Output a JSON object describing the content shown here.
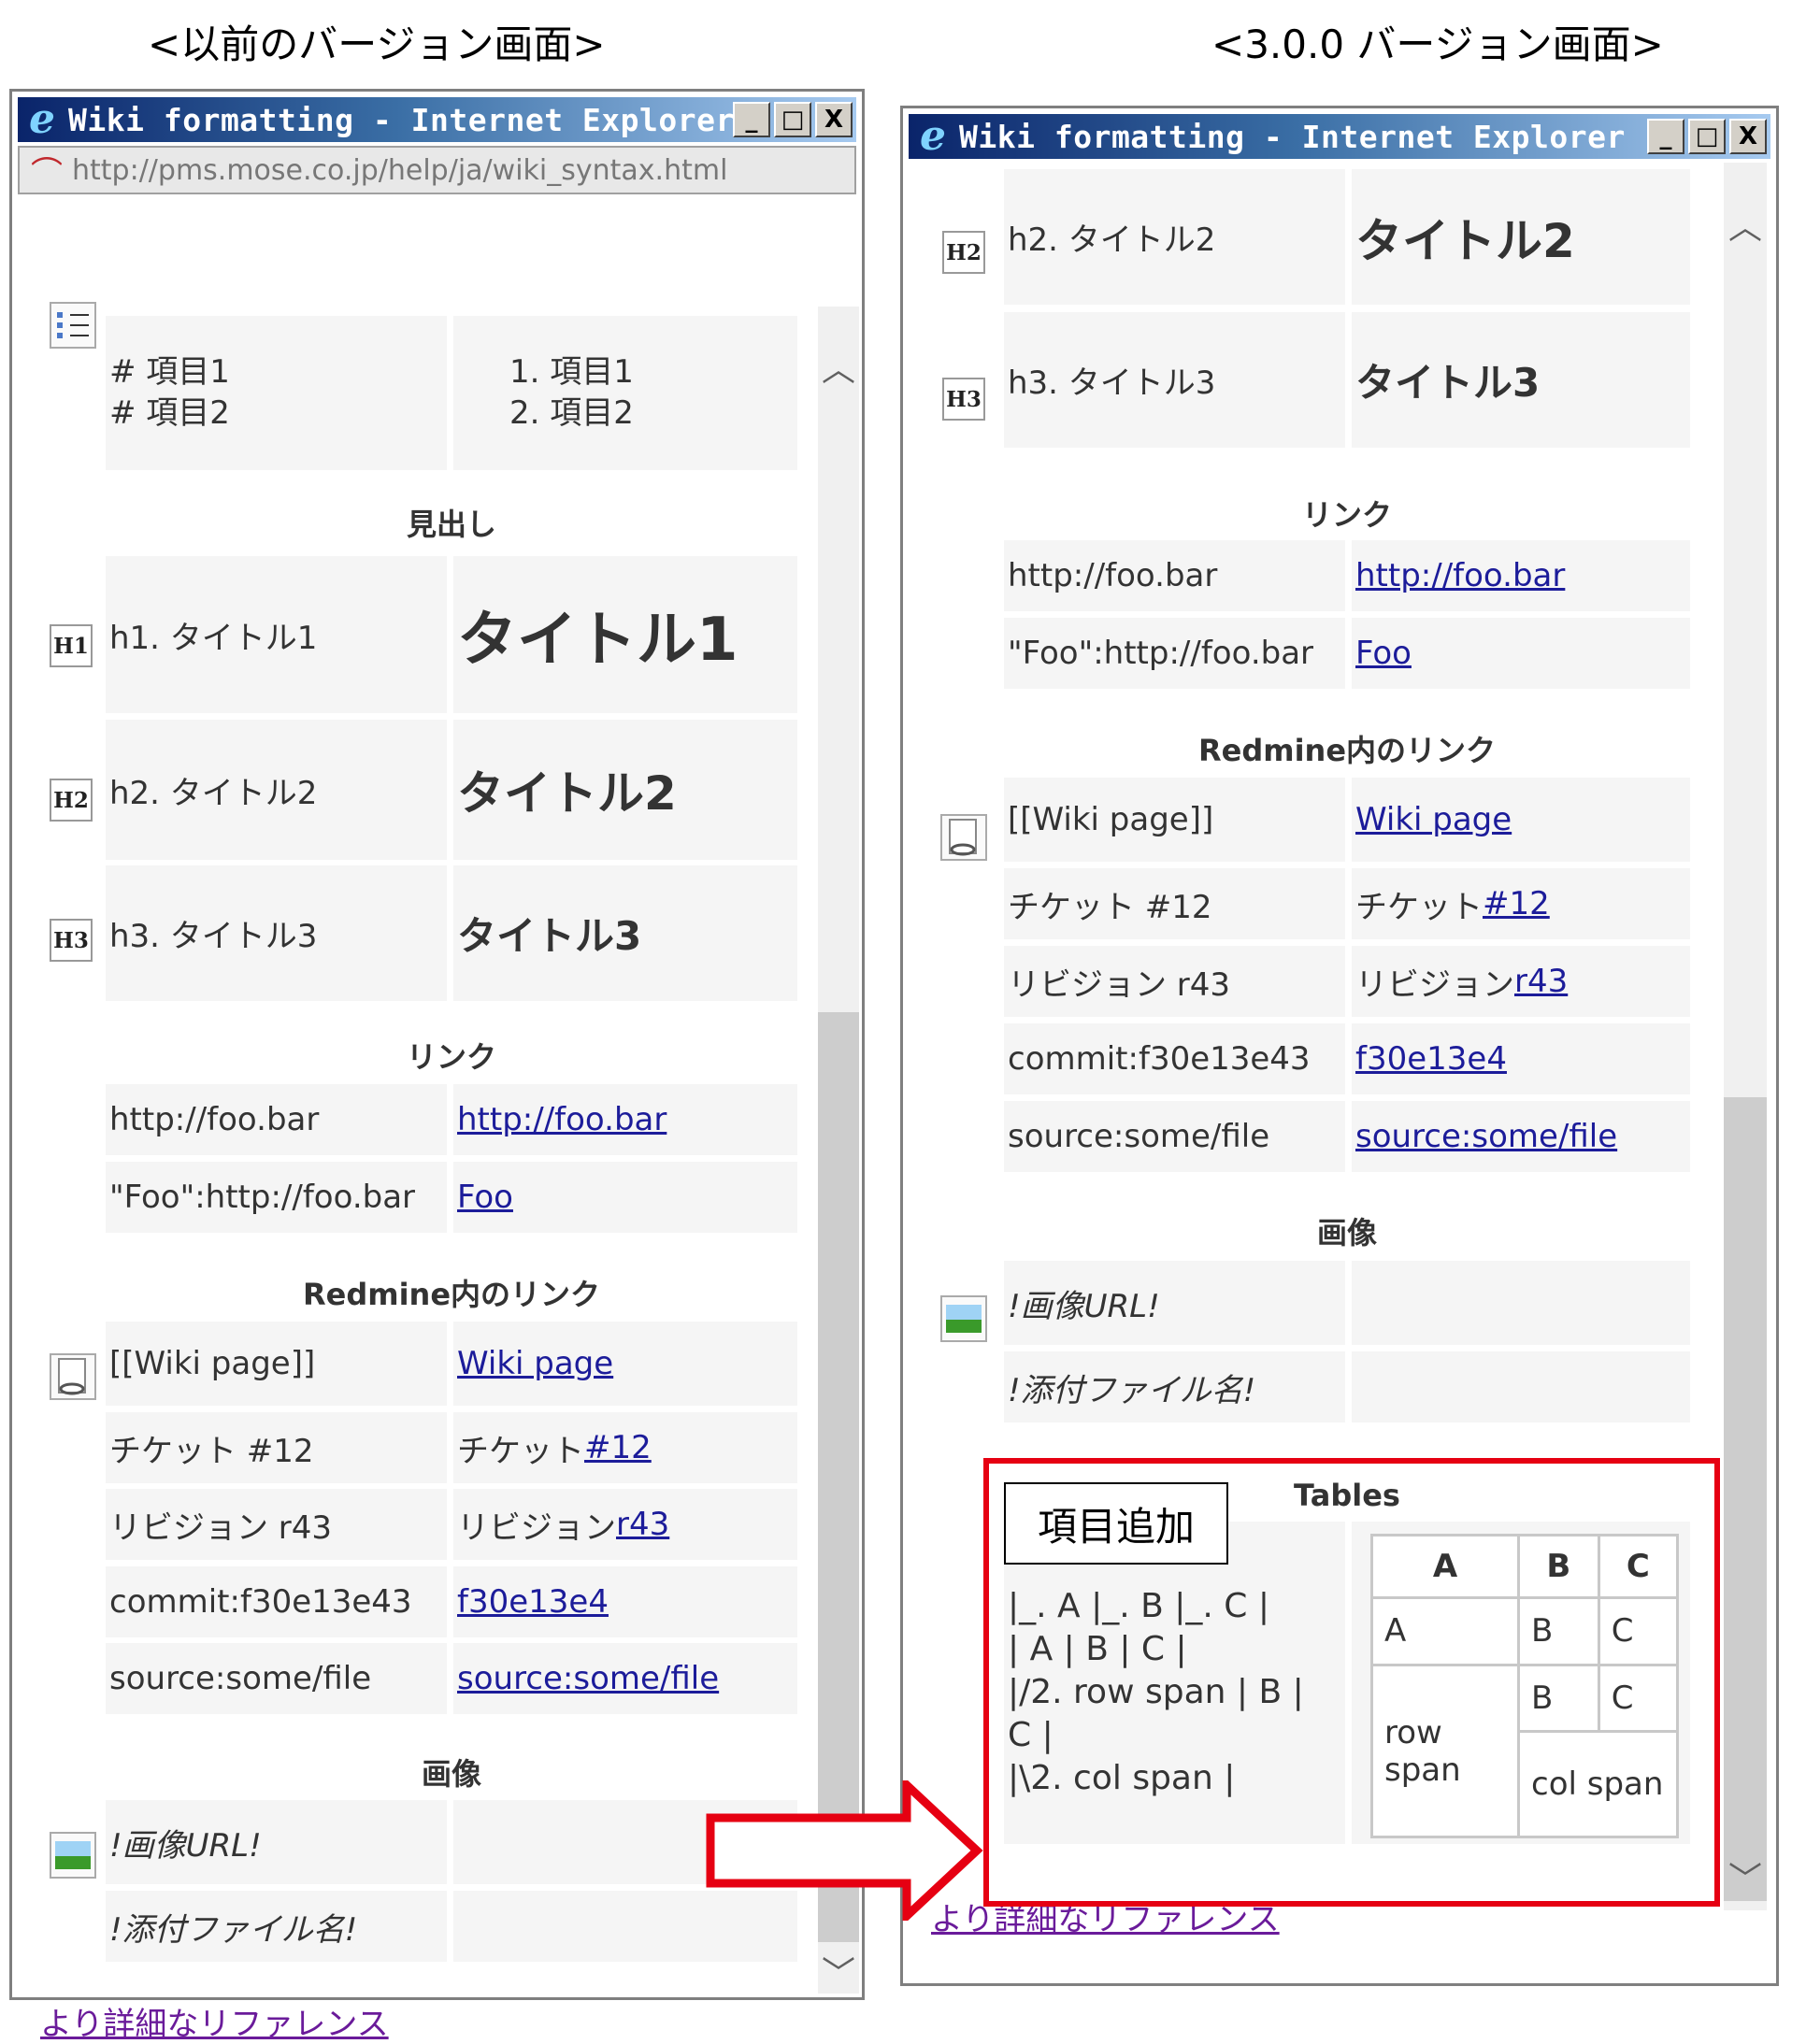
{
  "captions": {
    "left": "<以前のバージョン画面>",
    "right": "<3.0.0 バージョン画面>"
  },
  "left_window": {
    "title": "Wiki formatting - Internet Explorer",
    "window_buttons": [
      "_",
      "□",
      "X"
    ],
    "address": "http://pms.mose.co.jp/help/ja/wiki_syntax.html",
    "list": {
      "source": [
        "# 項目1",
        "# 項目2"
      ],
      "result": [
        "1.  項目1",
        "2.  項目2"
      ]
    },
    "headings_section": "見出し",
    "headings": [
      {
        "icon": "H1",
        "source": "h1. タイトル1",
        "result": "タイトル1"
      },
      {
        "icon": "H2",
        "source": "h2. タイトル2",
        "result": "タイトル2"
      },
      {
        "icon": "H3",
        "source": "h3. タイトル3",
        "result": "タイトル3"
      }
    ],
    "links_section": "リンク",
    "links": [
      {
        "source": "http://foo.bar",
        "result": "http://foo.bar"
      },
      {
        "source": "\"Foo\":http://foo.bar",
        "result": "Foo"
      }
    ],
    "redmine_section": "Redmine内のリンク",
    "redmine_links": [
      {
        "source": "[[Wiki page]]",
        "prefix": "",
        "result": "Wiki page"
      },
      {
        "source": "チケット #12",
        "prefix": "チケット ",
        "result": "#12"
      },
      {
        "source": "リビジョン r43",
        "prefix": "リビジョン ",
        "result": "r43"
      },
      {
        "source": "commit:f30e13e43",
        "prefix": "",
        "result": "f30e13e4"
      },
      {
        "source": "source:some/file",
        "prefix": "",
        "result": "source:some/file"
      }
    ],
    "images_section": "画像",
    "images": [
      "!画像URL!",
      "!添付ファイル名!"
    ],
    "more_link": "より詳細なリファレンス"
  },
  "right_window": {
    "title": "Wiki formatting - Internet Explorer",
    "window_buttons": [
      "_",
      "□",
      "X"
    ],
    "headings": [
      {
        "icon": "H2",
        "source": "h2. タイトル2",
        "result": "タイトル2"
      },
      {
        "icon": "H3",
        "source": "h3. タイトル3",
        "result": "タイトル3"
      }
    ],
    "links_section": "リンク",
    "links": [
      {
        "source": "http://foo.bar",
        "result": "http://foo.bar"
      },
      {
        "source": "\"Foo\":http://foo.bar",
        "result": "Foo"
      }
    ],
    "redmine_section": "Redmine内のリンク",
    "redmine_links": [
      {
        "source": "[[Wiki page]]",
        "prefix": "",
        "result": "Wiki page"
      },
      {
        "source": "チケット #12",
        "prefix": "チケット ",
        "result": "#12"
      },
      {
        "source": "リビジョン r43",
        "prefix": "リビジョン ",
        "result": "r43"
      },
      {
        "source": "commit:f30e13e43",
        "prefix": "",
        "result": "f30e13e4"
      },
      {
        "source": "source:some/file",
        "prefix": "",
        "result": "source:some/file"
      }
    ],
    "images_section": "画像",
    "images": [
      "!画像URL!",
      "!添付ファイル名!"
    ],
    "tables_section": "Tables",
    "add_label": "項目追加",
    "tables_source": "|_. A |_. B |_. C |\n| A | B | C |\n|/2. row span | B |\nC |\n|\\2. col span |",
    "demo_table": {
      "headers": [
        "A",
        "B",
        "C"
      ],
      "row1": [
        "A",
        "B",
        "C"
      ],
      "row2": [
        "row span",
        "B",
        "C"
      ],
      "row3": [
        "col span"
      ]
    },
    "more_link": "より詳細なリファレンス"
  },
  "colors": {
    "highlight": "#e60012",
    "link": "#1c1c9a",
    "visited": "#6a1b9a",
    "cell_bg": "#f5f5f5"
  }
}
